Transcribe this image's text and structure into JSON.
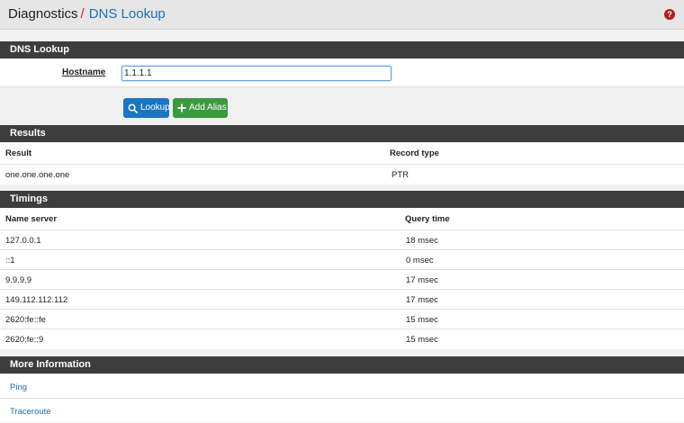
{
  "breadcrumb": {
    "section": "Diagnostics",
    "separator": "/",
    "page": "DNS Lookup"
  },
  "help_icon_glyph": "?",
  "dns_lookup": {
    "title": "DNS Lookup",
    "hostname_label": "Hostname",
    "hostname_value": "1.1.1.1",
    "lookup_label": "Lookup",
    "add_alias_label": "Add Alias"
  },
  "results": {
    "title": "Results",
    "headers": {
      "result": "Result",
      "record_type": "Record type"
    },
    "rows": [
      {
        "result": "one.one.one.one",
        "record_type": "PTR"
      }
    ]
  },
  "timings": {
    "title": "Timings",
    "headers": {
      "name_server": "Name server",
      "query_time": "Query time"
    },
    "rows": [
      {
        "server": "127.0.0.1",
        "time": "18 msec"
      },
      {
        "server": "::1",
        "time": "0 msec"
      },
      {
        "server": "9.9.9.9",
        "time": "17 msec"
      },
      {
        "server": "149.112.112.112",
        "time": "17 msec"
      },
      {
        "server": "2620:fe::fe",
        "time": "15 msec"
      },
      {
        "server": "2620:fe::9",
        "time": "15 msec"
      }
    ]
  },
  "more_information": {
    "title": "More Information",
    "links": [
      "Ping",
      "Traceroute"
    ]
  },
  "colors": {
    "header_bar": "#3d3d3d",
    "primary": "#1a76c2",
    "success": "#3a9a3e",
    "link": "#1f6fb5",
    "accent": "#c62828"
  }
}
